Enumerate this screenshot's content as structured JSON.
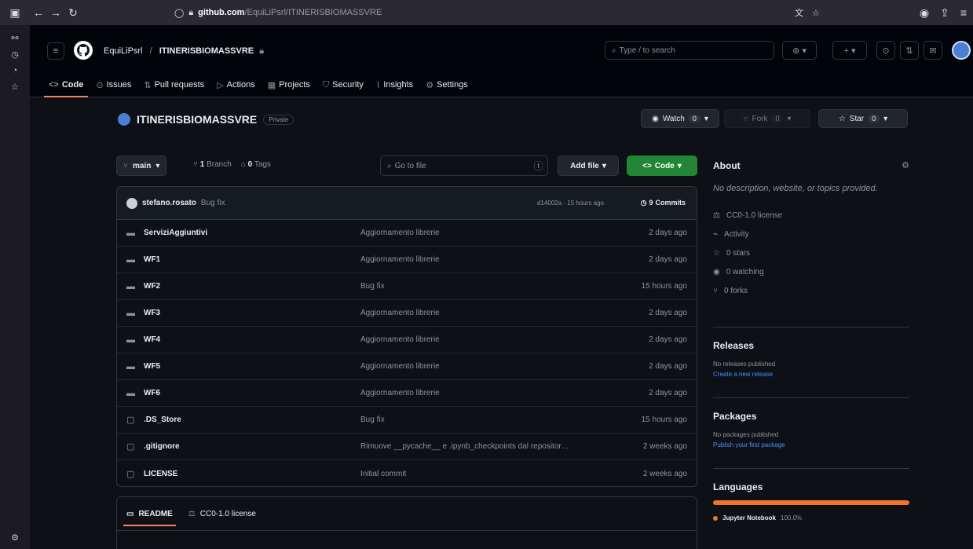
{
  "browser": {
    "url_host": "github.com",
    "url_path": "/EquiLiPsrl/ITINERISBIOMASSVRE"
  },
  "header": {
    "owner": "EquiLiPsrl",
    "separator": "/",
    "repo": "ITINERISBIOMASSVRE",
    "search_placeholder": "Type / to search"
  },
  "tabs": [
    {
      "label": "Code",
      "icon": "code-icon"
    },
    {
      "label": "Issues",
      "icon": "issue-icon"
    },
    {
      "label": "Pull requests",
      "icon": "pull-request-icon"
    },
    {
      "label": "Actions",
      "icon": "play-icon"
    },
    {
      "label": "Projects",
      "icon": "table-icon"
    },
    {
      "label": "Security",
      "icon": "shield-icon"
    },
    {
      "label": "Insights",
      "icon": "graph-icon"
    },
    {
      "label": "Settings",
      "icon": "gear-icon"
    }
  ],
  "repo": {
    "name": "ITINERISBIOMASSVRE",
    "visibility": "Private",
    "watch_label": "Watch",
    "watch_count": "0",
    "fork_label": "Fork",
    "fork_count": "0",
    "star_label": "Star",
    "star_count": "0"
  },
  "toolbar": {
    "branch": "main",
    "branch_count": "1",
    "branch_label": "Branch",
    "tag_count": "0",
    "tag_label": "Tags",
    "goto_placeholder": "Go to file",
    "goto_kbd": "t",
    "add_file": "Add file",
    "code": "Code"
  },
  "commit": {
    "author": "stefano.rosato",
    "message": "Bug fix",
    "hash_time": "d14002a · 15 hours ago",
    "commits_count": "9",
    "commits_label": "Commits"
  },
  "files": [
    {
      "type": "dir",
      "name": "ServiziAggiuntivi",
      "msg": "Aggiornamento librerie",
      "date": "2 days ago"
    },
    {
      "type": "dir",
      "name": "WF1",
      "msg": "Aggiornamento librerie",
      "date": "2 days ago"
    },
    {
      "type": "dir",
      "name": "WF2",
      "msg": "Bug fix",
      "date": "15 hours ago"
    },
    {
      "type": "dir",
      "name": "WF3",
      "msg": "Aggiornamento librerie",
      "date": "2 days ago"
    },
    {
      "type": "dir",
      "name": "WF4",
      "msg": "Aggiornamento librerie",
      "date": "2 days ago"
    },
    {
      "type": "dir",
      "name": "WF5",
      "msg": "Aggiornamento librerie",
      "date": "2 days ago"
    },
    {
      "type": "dir",
      "name": "WF6",
      "msg": "Aggiornamento librerie",
      "date": "2 days ago"
    },
    {
      "type": "file",
      "name": ".DS_Store",
      "msg": "Bug fix",
      "date": "15 hours ago"
    },
    {
      "type": "file",
      "name": ".gitignore",
      "msg": "Rimuove __pycache__ e .ipynb_checkpoints dal repositor…",
      "date": "2 weeks ago"
    },
    {
      "type": "file",
      "name": "LICENSE",
      "msg": "Initial commit",
      "date": "2 weeks ago"
    }
  ],
  "readme_tabs": {
    "readme": "README",
    "license": "CC0-1.0 license"
  },
  "about": {
    "title": "About",
    "description": "No description, website, or topics provided.",
    "license": "CC0-1.0 license",
    "activity": "Activity",
    "stars": "0 stars",
    "watching": "0 watching",
    "forks": "0 forks"
  },
  "releases": {
    "title": "Releases",
    "text": "No releases published",
    "link": "Create a new release"
  },
  "packages": {
    "title": "Packages",
    "text": "No packages published",
    "link": "Publish your first package"
  },
  "languages": {
    "title": "Languages",
    "name": "Jupyter Notebook",
    "percent": "100.0%",
    "color": "#f1742c"
  }
}
